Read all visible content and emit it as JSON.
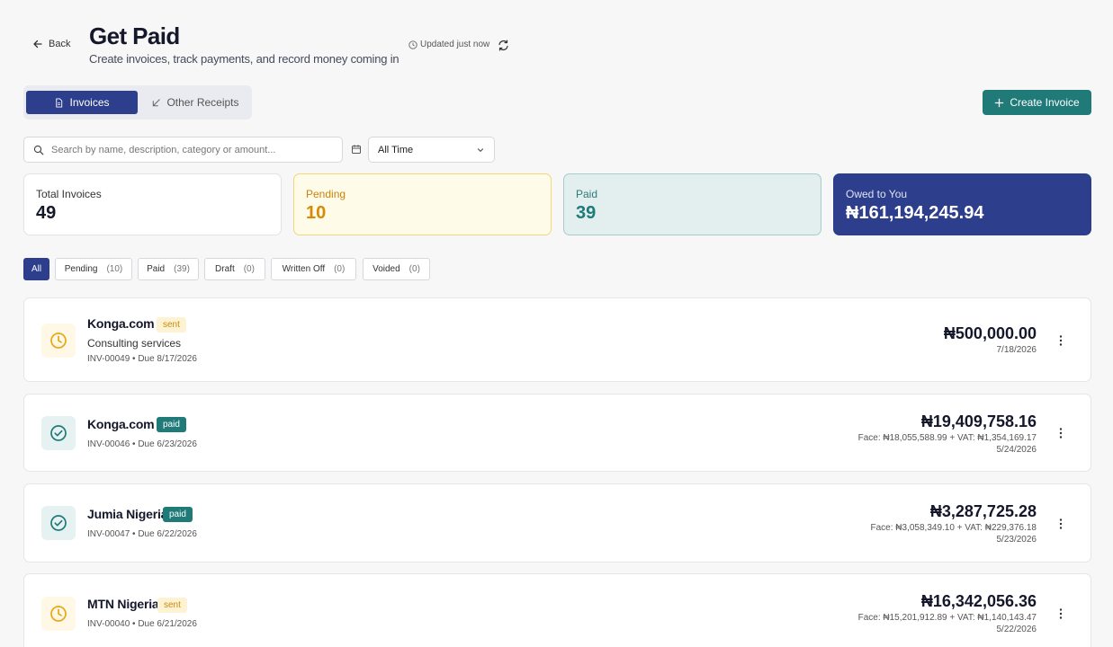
{
  "header": {
    "back_label": "Back",
    "title": "Get Paid",
    "subtitle": "Create invoices, track payments, and record money coming in",
    "updated": "Updated just now"
  },
  "tabs": [
    {
      "label": "Invoices",
      "active": true
    },
    {
      "label": "Other Receipts",
      "active": false
    }
  ],
  "create_button": "Create Invoice",
  "search": {
    "placeholder": "Search by name, description, category or amount..."
  },
  "date_filter": {
    "selected": "All Time"
  },
  "stats": {
    "total": {
      "label": "Total Invoices",
      "value": "49"
    },
    "pending": {
      "label": "Pending",
      "value": "10"
    },
    "paid": {
      "label": "Paid",
      "value": "39"
    },
    "owed": {
      "label": "Owed to You",
      "value": "₦161,194,245.94"
    }
  },
  "filters": [
    {
      "label": "All",
      "count": ""
    },
    {
      "label": "Pending",
      "count": "(10)"
    },
    {
      "label": "Paid",
      "count": "(39)"
    },
    {
      "label": "Draft",
      "count": "(0)"
    },
    {
      "label": "Written Off",
      "count": "(0)"
    },
    {
      "label": "Voided",
      "count": "(0)"
    }
  ],
  "invoices": [
    {
      "client": "Konga.com",
      "status": "sent",
      "icon": "clock-icon",
      "description": "Consulting services",
      "meta": "INV-00049 • Due 8/17/2026",
      "amount": "₦500,000.00",
      "breakdown": "",
      "date": "7/18/2026"
    },
    {
      "client": "Konga.com",
      "status": "paid",
      "icon": "check-circle-icon",
      "description": "",
      "meta": "INV-00046 • Due 6/23/2026",
      "amount": "₦19,409,758.16",
      "breakdown": "Face: ₦18,055,588.99 + VAT: ₦1,354,169.17",
      "date": "5/24/2026"
    },
    {
      "client": "Jumia Nigeria",
      "status": "paid",
      "icon": "check-circle-icon",
      "description": "",
      "meta": "INV-00047 • Due 6/22/2026",
      "amount": "₦3,287,725.28",
      "breakdown": "Face: ₦3,058,349.10 + VAT: ₦229,376.18",
      "date": "5/23/2026"
    },
    {
      "client": "MTN Nigeria",
      "status": "sent",
      "icon": "clock-icon",
      "description": "",
      "meta": "INV-00040 • Due 6/21/2026",
      "amount": "₦16,342,056.36",
      "breakdown": "Face: ₦15,201,912.89 + VAT: ₦1,140,143.47",
      "date": "5/22/2026"
    }
  ],
  "colors": {
    "primary": "#2c3e8c",
    "teal": "#1f7a78",
    "amber": "#d68a07"
  }
}
